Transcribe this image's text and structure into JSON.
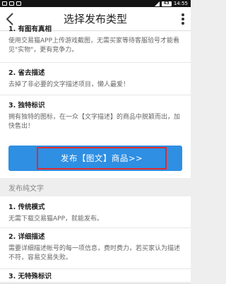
{
  "status_bar": {
    "carrier_icons": [
      "notification-icon",
      "notification-icon",
      "notification-icon"
    ],
    "battery": "63",
    "time": "14:55"
  },
  "header": {
    "title": "选择发布类型",
    "back_icon": "chevron-left-icon",
    "more_icon": "more-vertical-icon"
  },
  "image_text_card": {
    "sections": [
      {
        "title": "1. 有图有真相",
        "desc": "使用交易猫APP上传游戏截图，无需买家等待客服验号才能看见\"实物\"，更有竞争力。"
      },
      {
        "title": "2. 省去描述",
        "desc": "去掉了非必要的文字描述项目，懒人最爱！"
      },
      {
        "title": "3. 独特标识",
        "desc": "拥有独特的图标，在一众【文字描述】的商品中脱颖而出，加快售出！"
      }
    ],
    "publish_button": "发布【图文】商品>>"
  },
  "text_only": {
    "section_label": "发布纯文字",
    "sections": [
      {
        "title": "1. 传统模式",
        "desc": "无需下载交易猫APP，就能发布。"
      },
      {
        "title": "2. 详细描述",
        "desc": "需要详细描述帐号的每一项信息，费时费力，若买家认为描述不符，容易交易失败。"
      },
      {
        "title": "3. 无特殊标识",
        "desc": ""
      }
    ]
  },
  "colors": {
    "primary_button": "#2f8fe3",
    "highlight_border": "#e02b2b"
  }
}
